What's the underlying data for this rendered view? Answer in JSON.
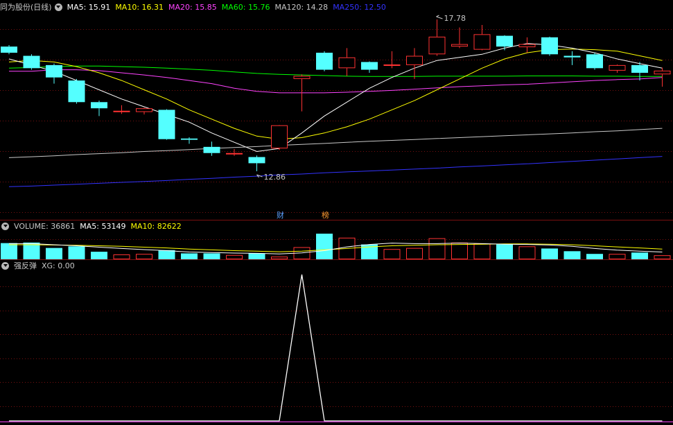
{
  "price_panel": {
    "stock_title": "同为股份(日线)",
    "ma5": "MA5: 15.91",
    "ma10": "MA10: 16.31",
    "ma20": "MA20: 15.85",
    "ma60": "MA60: 15.76",
    "ma120": "MA120: 14.28",
    "ma250": "MA250: 12.50",
    "high_marker": "17.78",
    "low_marker": "12.86",
    "badge_finance": "财",
    "badge_ranking": "榜"
  },
  "volume_panel": {
    "volume": "VOLUME: 36861",
    "ma5": "MA5: 53149",
    "ma10": "MA10: 82622"
  },
  "indicator_panel": {
    "name": "强反弹",
    "xg": "XG: 0.00"
  },
  "colors": {
    "up": "#ff3232",
    "down": "#54ffff",
    "ma5": "#ffffff",
    "ma10": "#ffff00",
    "ma20": "#ff44ff",
    "ma60": "#00ff00",
    "ma120": "#c8c8c8",
    "ma250": "#3333ff",
    "grid": "#7a1010"
  },
  "chart_data": {
    "type": "candlestick",
    "price_range_hint": [
      12.5,
      18.0
    ],
    "candles": [
      {
        "o": 16.9,
        "c": 16.7,
        "h": 16.95,
        "l": 16.65
      },
      {
        "o": 16.6,
        "c": 16.2,
        "h": 16.65,
        "l": 16.15
      },
      {
        "o": 16.3,
        "c": 15.9,
        "h": 16.35,
        "l": 15.7
      },
      {
        "o": 15.8,
        "c": 15.1,
        "h": 15.85,
        "l": 15.05
      },
      {
        "o": 15.1,
        "c": 14.9,
        "h": 15.15,
        "l": 14.65
      },
      {
        "o": 14.78,
        "c": 14.82,
        "h": 15.0,
        "l": 14.72
      },
      {
        "o": 14.78,
        "c": 14.9,
        "h": 14.92,
        "l": 14.7
      },
      {
        "o": 14.85,
        "c": 13.9,
        "h": 14.87,
        "l": 13.88
      },
      {
        "o": 13.92,
        "c": 13.88,
        "h": 13.96,
        "l": 13.75
      },
      {
        "o": 13.65,
        "c": 13.45,
        "h": 13.82,
        "l": 13.36
      },
      {
        "o": 13.42,
        "c": 13.45,
        "h": 13.58,
        "l": 13.36
      },
      {
        "o": 13.32,
        "c": 13.12,
        "h": 13.37,
        "l": 12.86
      },
      {
        "o": 13.6,
        "c": 14.35,
        "h": 14.36,
        "l": 13.55
      },
      {
        "o": 15.85,
        "c": 15.95,
        "h": 16.0,
        "l": 14.8
      },
      {
        "o": 16.7,
        "c": 16.15,
        "h": 16.75,
        "l": 16.1
      },
      {
        "o": 16.2,
        "c": 16.55,
        "h": 16.85,
        "l": 15.95
      },
      {
        "o": 16.4,
        "c": 16.15,
        "h": 16.42,
        "l": 16.05
      },
      {
        "o": 16.28,
        "c": 16.32,
        "h": 16.75,
        "l": 16.2
      },
      {
        "o": 16.3,
        "c": 16.6,
        "h": 16.85,
        "l": 15.85
      },
      {
        "o": 16.65,
        "c": 17.22,
        "h": 17.78,
        "l": 16.6
      },
      {
        "o": 16.9,
        "c": 16.98,
        "h": 17.52,
        "l": 16.85
      },
      {
        "o": 16.8,
        "c": 17.3,
        "h": 17.6,
        "l": 16.78
      },
      {
        "o": 17.25,
        "c": 16.9,
        "h": 17.27,
        "l": 16.78
      },
      {
        "o": 16.88,
        "c": 16.98,
        "h": 17.2,
        "l": 16.7
      },
      {
        "o": 17.2,
        "c": 16.65,
        "h": 17.22,
        "l": 16.6
      },
      {
        "o": 16.6,
        "c": 16.55,
        "h": 16.75,
        "l": 16.3
      },
      {
        "o": 16.65,
        "c": 16.2,
        "h": 16.7,
        "l": 16.15
      },
      {
        "o": 16.12,
        "c": 16.3,
        "h": 16.32,
        "l": 16.05
      },
      {
        "o": 16.3,
        "c": 16.05,
        "h": 16.4,
        "l": 15.8
      },
      {
        "o": 16.0,
        "c": 16.12,
        "h": 16.22,
        "l": 15.6
      }
    ],
    "ma5": [
      16.5,
      16.3,
      16.1,
      15.8,
      15.5,
      15.2,
      14.95,
      14.7,
      14.45,
      14.1,
      13.8,
      13.5,
      13.6,
      14.1,
      14.65,
      15.1,
      15.55,
      15.9,
      16.2,
      16.45,
      16.55,
      16.65,
      16.85,
      17.0,
      16.95,
      16.85,
      16.7,
      16.5,
      16.35,
      16.2
    ],
    "ma10": [
      16.4,
      16.45,
      16.4,
      16.25,
      16.05,
      15.8,
      15.5,
      15.2,
      14.85,
      14.55,
      14.25,
      14.0,
      13.9,
      13.95,
      14.1,
      14.3,
      14.55,
      14.85,
      15.15,
      15.5,
      15.85,
      16.2,
      16.5,
      16.7,
      16.8,
      16.82,
      16.8,
      16.75,
      16.6,
      16.45
    ],
    "ma20": [
      16.1,
      16.1,
      16.15,
      16.15,
      16.12,
      16.05,
      15.98,
      15.9,
      15.8,
      15.7,
      15.55,
      15.45,
      15.4,
      15.4,
      15.4,
      15.42,
      15.45,
      15.48,
      15.52,
      15.56,
      15.6,
      15.63,
      15.66,
      15.68,
      15.72,
      15.76,
      15.8,
      15.83,
      15.85,
      15.9
    ],
    "ma60": [
      16.2,
      16.22,
      16.25,
      16.27,
      16.27,
      16.25,
      16.23,
      16.2,
      16.17,
      16.13,
      16.08,
      16.03,
      16.0,
      15.98,
      15.96,
      15.94,
      15.93,
      15.93,
      15.93,
      15.94,
      15.94,
      15.94,
      15.94,
      15.95,
      15.95,
      15.95,
      15.94,
      15.94,
      15.93,
      15.93
    ],
    "ma120": [
      13.3,
      13.33,
      13.36,
      13.4,
      13.43,
      13.46,
      13.5,
      13.53,
      13.56,
      13.6,
      13.63,
      13.66,
      13.7,
      13.73,
      13.76,
      13.8,
      13.83,
      13.86,
      13.89,
      13.92,
      13.95,
      13.98,
      14.01,
      14.04,
      14.07,
      14.1,
      14.14,
      14.17,
      14.21,
      14.25
    ],
    "ma250": [
      12.36,
      12.38,
      12.41,
      12.44,
      12.47,
      12.5,
      12.53,
      12.56,
      12.6,
      12.63,
      12.67,
      12.7,
      12.74,
      12.77,
      12.81,
      12.84,
      12.87,
      12.9,
      12.93,
      12.96,
      13.0,
      13.03,
      13.07,
      13.1,
      13.14,
      13.18,
      13.22,
      13.26,
      13.3,
      13.34
    ],
    "volume": [
      60000,
      62000,
      42000,
      48000,
      28000,
      18000,
      20000,
      34000,
      22000,
      22000,
      16000,
      22000,
      10000,
      45000,
      95000,
      80000,
      55000,
      38000,
      42000,
      78000,
      62000,
      58000,
      55000,
      48000,
      40000,
      30000,
      20000,
      20000,
      25000,
      15000
    ],
    "volume_ma5": [
      58000,
      58000,
      54000,
      50000,
      45000,
      40000,
      36000,
      32000,
      27000,
      25000,
      23000,
      22000,
      20000,
      24000,
      32000,
      46000,
      55000,
      60000,
      58000,
      58000,
      60000,
      58000,
      56000,
      55000,
      53000,
      48000,
      40000,
      34000,
      30000,
      27000
    ],
    "volume_ma10": [
      54000,
      54000,
      53000,
      52000,
      50000,
      48000,
      45000,
      42000,
      38000,
      35000,
      32000,
      30000,
      28000,
      30000,
      35000,
      40000,
      46000,
      50000,
      52000,
      54000,
      55000,
      56000,
      57000,
      57000,
      56000,
      54000,
      50000,
      46000,
      42000,
      38000
    ],
    "signal": [
      0,
      0,
      0,
      0,
      0,
      0,
      0,
      0,
      0,
      0,
      0,
      0,
      0,
      1,
      0,
      0,
      0,
      0,
      0,
      0,
      0,
      0,
      0,
      0,
      0,
      0,
      0,
      0,
      0,
      0
    ]
  }
}
